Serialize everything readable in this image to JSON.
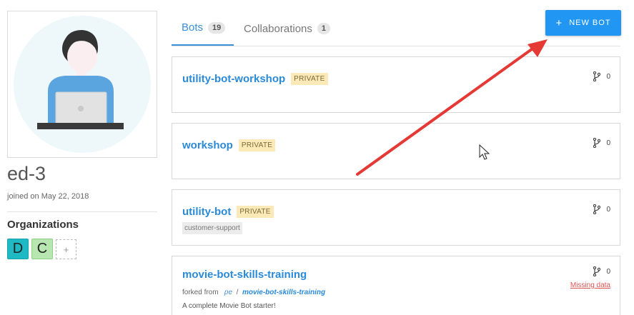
{
  "profile": {
    "username": "ed-3",
    "joined": "joined on May 22, 2018",
    "organizations_heading": "Organizations",
    "organizations": [
      {
        "letter": "D",
        "color": "#1fb9c4"
      },
      {
        "letter": "C",
        "color": "#b8e6b1"
      }
    ],
    "add_org_label": "+"
  },
  "tabs": [
    {
      "label": "Bots",
      "count": "19",
      "active": true
    },
    {
      "label": "Collaborations",
      "count": "1",
      "active": false
    }
  ],
  "new_bot_button": {
    "icon": "+",
    "label": "NEW BOT"
  },
  "bots": [
    {
      "name": "utility-bot-workshop",
      "badge": "PRIVATE",
      "forks": "0"
    },
    {
      "name": "workshop",
      "badge": "PRIVATE",
      "forks": "0"
    },
    {
      "name": "utility-bot",
      "badge": "PRIVATE",
      "forks": "0",
      "tag": "customer-support"
    },
    {
      "name": "movie-bot-skills-training",
      "forks": "0",
      "forked_prefix": "forked from",
      "forked_user": "pe",
      "forked_sep": "/",
      "forked_bot": "movie-bot-skills-training",
      "description": "A complete Movie Bot starter!",
      "warning": "Missing data"
    }
  ],
  "colors": {
    "accent": "#2196f3",
    "link": "#2a8ad8",
    "private_badge": "#fbe9b7",
    "warning": "#e05353",
    "annotation_arrow": "#e53935"
  },
  "icons": {
    "fork": "fork-icon",
    "cursor": "mouse-cursor-icon",
    "annotation": "red-arrow-annotation"
  }
}
